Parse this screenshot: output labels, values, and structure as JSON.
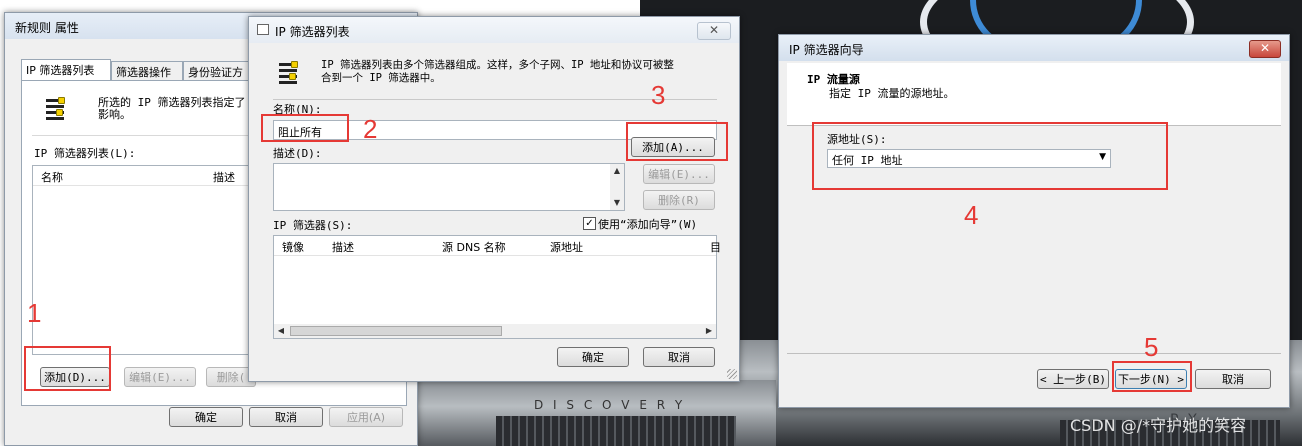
{
  "dialog_main": {
    "title": "新规则 属性",
    "tabs": [
      "IP 筛选器列表",
      "筛选器操作",
      "身份验证方"
    ],
    "desc": "所选的 IP 筛选器列表指定了",
    "desc2": "影响。",
    "list_label": "IP 筛选器列表(L):",
    "col_name": "名称",
    "col_desc": "描述",
    "add_button": "添加(D)...",
    "edit_button": "编辑(E)...",
    "remove_button": "删除(",
    "ok_button": "确定",
    "cancel_button": "取消",
    "apply_button": "应用(A)"
  },
  "dialog_list": {
    "title": "IP 筛选器列表",
    "desc_line1": "IP 筛选器列表由多个筛选器组成。这样，多个子网、IP 地址和协议可被整",
    "desc_line2": "合到一个 IP 筛选器中。",
    "name_label": "名称(N):",
    "name_value": "阻止所有",
    "description_label": "描述(D):",
    "add_button": "添加(A)...",
    "edit_button": "编辑(E)...",
    "remove_button": "删除(R)",
    "filters_label": "IP 筛选器(S):",
    "wizard_checkbox_label": "使用“添加向导”(W)",
    "col_mirror": "镜像",
    "col_desc": "描述",
    "col_src_dns": "源 DNS 名称",
    "col_src_addr": "源地址",
    "col_more": "目",
    "ok_button": "确定",
    "cancel_button": "取消"
  },
  "dialog_wizard": {
    "title": "IP 筛选器向导",
    "heading": "IP 流量源",
    "subheading": "指定 IP 流量的源地址。",
    "source_label": "源地址(S):",
    "source_value": "任何 IP 地址",
    "back_button": "< 上一步(B)",
    "next_button": "下一步(N) >",
    "cancel_button": "取消"
  },
  "annotations": [
    "1",
    "2",
    "3",
    "4",
    "5"
  ],
  "watermark": "CSDN @/*守护她的笑容",
  "car_badge": "D I S C O V E R Y",
  "colors": {
    "annotation": "#e53935",
    "title_bar": "#dbe5f1",
    "dialog_bg": "#f0f0f0"
  }
}
